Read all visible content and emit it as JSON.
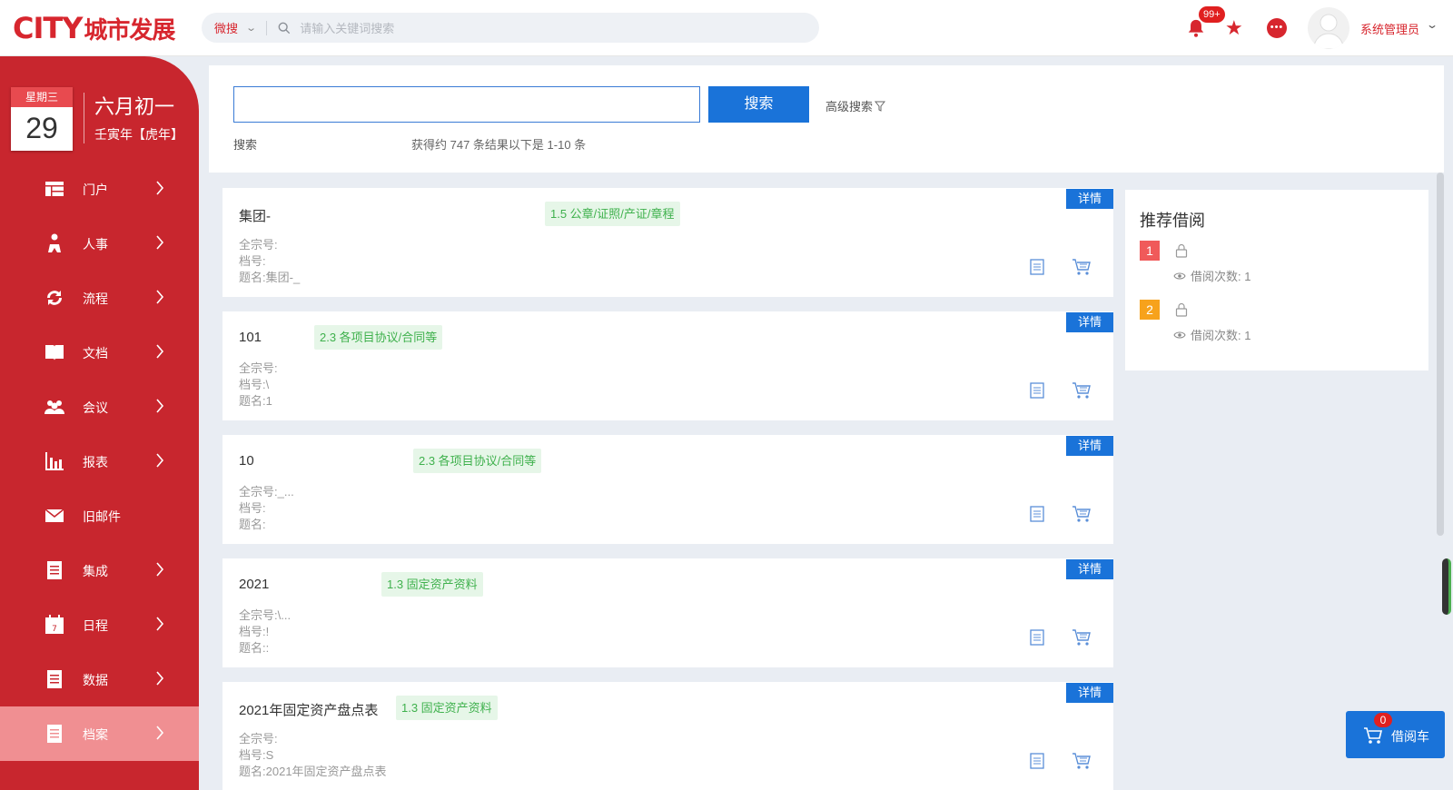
{
  "app": {
    "logo_en": "CITY",
    "logo_cn": "城市发展",
    "accent": "#c8262e",
    "primary": "#1a73d9"
  },
  "topbar": {
    "search_scope": "微搜",
    "search_placeholder": "请输入关键词搜索",
    "notification_count": "99+",
    "username": "系统管理员"
  },
  "sidebar": {
    "weekday": "星期三",
    "day": "29",
    "lunar_date": "六月初一",
    "ganzhi": "壬寅年【虎年】",
    "items": [
      {
        "label": "门户",
        "icon": "portal-icon"
      },
      {
        "label": "人事",
        "icon": "person-icon"
      },
      {
        "label": "流程",
        "icon": "flow-icon"
      },
      {
        "label": "文档",
        "icon": "book-icon"
      },
      {
        "label": "会议",
        "icon": "meeting-icon"
      },
      {
        "label": "报表",
        "icon": "bar-chart-icon"
      },
      {
        "label": "旧邮件",
        "icon": "mail-icon"
      },
      {
        "label": "集成",
        "icon": "document-icon"
      },
      {
        "label": "日程",
        "icon": "calendar-icon"
      },
      {
        "label": "数据",
        "icon": "document-icon"
      },
      {
        "label": "档案",
        "icon": "document-icon"
      }
    ]
  },
  "search": {
    "value": "",
    "button_label": "搜索",
    "advanced_label": "高级搜索",
    "label": "搜索",
    "result_summary": "获得约 747 条结果以下是 1-10 条"
  },
  "results": [
    {
      "title": "集团-",
      "tag": "1.5 公章/证照/产证/章程",
      "fonds_label": "全宗号:",
      "fonds_value": "",
      "file_label": "档号:",
      "file_value": "",
      "name_label": "题名:",
      "name_value": "集团-_",
      "detail": "详情"
    },
    {
      "title": "101",
      "tag": "2.3 各项目协议/合同等",
      "fonds_label": "全宗号:",
      "fonds_value": "",
      "file_label": "档号:",
      "file_value": "\\",
      "name_label": "题名:",
      "name_value": "1",
      "detail": "详情"
    },
    {
      "title": "10",
      "tag": "2.3 各项目协议/合同等",
      "fonds_label": "全宗号:",
      "fonds_value": "_...",
      "file_label": "档号:",
      "file_value": "",
      "name_label": "题名:",
      "name_value": "",
      "detail": "详情"
    },
    {
      "title": "2021",
      "tag": "1.3 固定资产资料",
      "fonds_label": "全宗号:",
      "fonds_value": "\\...",
      "file_label": "档号:",
      "file_value": "!",
      "name_label": "题名:",
      "name_value": ":",
      "detail": "详情"
    },
    {
      "title": "2021年固定资产盘点表",
      "tag": "1.3 固定资产资料",
      "fonds_label": "全宗号:",
      "fonds_value": "",
      "file_label": "档号:",
      "file_value": "S",
      "name_label": "题名:",
      "name_value": "2021年固定资产盘点表",
      "detail": "详情"
    }
  ],
  "recommend": {
    "title": "推荐借阅",
    "items": [
      {
        "rank": "1",
        "color": "#f05a5a",
        "reads_label": "借阅次数: 1"
      },
      {
        "rank": "2",
        "color": "#f7a21c",
        "reads_label": "借阅次数: 1"
      }
    ]
  },
  "borrow_cart": {
    "count": "0",
    "label": "借阅车"
  }
}
